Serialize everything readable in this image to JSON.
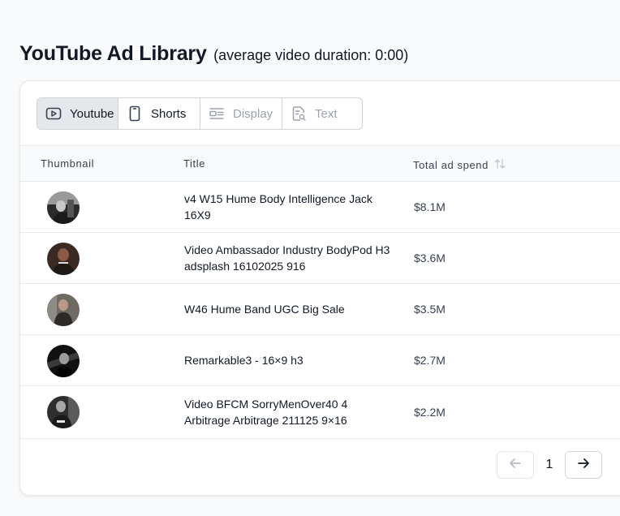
{
  "header": {
    "title": "YouTube Ad Library",
    "subtitle": "(average video duration: 0:00)"
  },
  "tabs": [
    {
      "label": "Youtube",
      "icon": "play-icon",
      "state": "active"
    },
    {
      "label": "Shorts",
      "icon": "phone-icon",
      "state": "enabled"
    },
    {
      "label": "Display",
      "icon": "display-icon",
      "state": "disabled"
    },
    {
      "label": "Text",
      "icon": "text-search-icon",
      "state": "disabled"
    }
  ],
  "table": {
    "columns": {
      "thumbnail": "Thumbnail",
      "title": "Title",
      "spend": "Total ad spend"
    },
    "rows": [
      {
        "title": "v4 W15 Hume Body Intelligence Jack 16X9",
        "spend": "$8.1M"
      },
      {
        "title": "Video Ambassador Industry BodyPod H3 adsplash 16102025 916",
        "spend": "$3.6M"
      },
      {
        "title": "W46 Hume Band UGC Big Sale",
        "spend": "$3.5M"
      },
      {
        "title": "Remarkable3 - 16×9 h3",
        "spend": "$2.7M"
      },
      {
        "title": "Video BFCM SorryMenOver40 4 Arbitrage Arbitrage 211125 9×16",
        "spend": "$2.2M"
      }
    ]
  },
  "pagination": {
    "current_page": "1"
  },
  "colors": {
    "active_tab_bg": "#e5e7eb",
    "border": "#d1d5db",
    "muted_text": "#9ca3af"
  }
}
